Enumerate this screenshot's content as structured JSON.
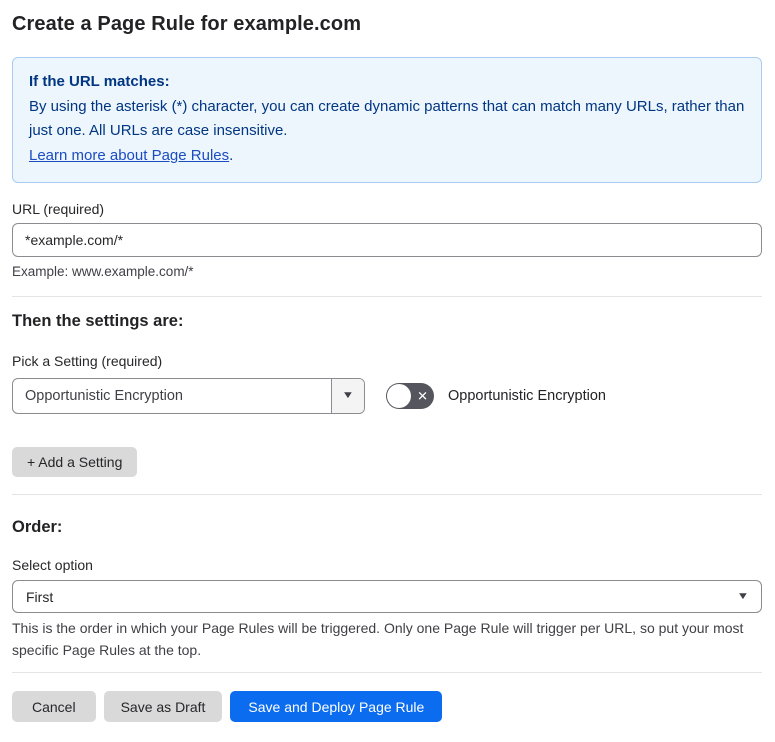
{
  "page": {
    "title": "Create a Page Rule for example.com"
  },
  "info_box": {
    "heading": "If the URL matches:",
    "body": "By using the asterisk (*) character, you can create dynamic patterns that can match many URLs, rather than just one. All URLs are case insensitive.",
    "link_text": "Learn more about Page Rules",
    "link_suffix": "."
  },
  "url_field": {
    "label": "URL (required)",
    "value": "*example.com/*",
    "example": "Example: www.example.com/*"
  },
  "settings_section": {
    "heading": "Then the settings are:",
    "picker_label": "Pick a Setting (required)",
    "picker_value": "Opportunistic Encryption",
    "toggle_label": "Opportunistic Encryption",
    "toggle_state": "off",
    "add_button_label": "+ Add a Setting"
  },
  "order_section": {
    "heading": "Order:",
    "select_label": "Select option",
    "select_value": "First",
    "help_text": "This is the order in which your Page Rules will be triggered. Only one Page Rule will trigger per URL, so put your most specific Page Rules at the top."
  },
  "footer": {
    "cancel_label": "Cancel",
    "save_draft_label": "Save as Draft",
    "save_deploy_label": "Save and Deploy Page Rule"
  },
  "icons": {
    "select_chevron": "chevron-down-icon",
    "toggle_off_glyph": "x-icon"
  },
  "colors": {
    "info_background": "#edf5fd",
    "info_border": "#a9cdf1",
    "info_text": "#003682",
    "link_blue": "#1b4cc0",
    "primary_button_blue": "#0b6cf0",
    "gray_button": "#d9d9d9",
    "toggle_off_background": "#55555e",
    "divider": "#e4e4e7",
    "input_border": "#8b8b90"
  }
}
